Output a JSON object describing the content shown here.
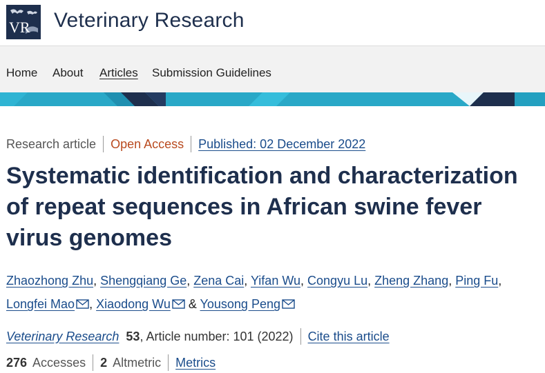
{
  "header": {
    "logo_text": "VR",
    "journal_title": "Veterinary Research"
  },
  "nav": {
    "items": [
      {
        "label": "Home"
      },
      {
        "label": "About"
      },
      {
        "label": "Articles"
      },
      {
        "label": "Submission Guidelines"
      }
    ],
    "active": "Articles"
  },
  "meta": {
    "type": "Research article",
    "access": "Open Access",
    "published": "Published: 02 December 2022"
  },
  "article": {
    "title": "Systematic identification and characterization of repeat sequences in African swine fever virus genomes"
  },
  "authors": [
    {
      "name": "Zhaozhong Zhu",
      "corresponding": false
    },
    {
      "name": "Shengqiang Ge",
      "corresponding": false
    },
    {
      "name": "Zena Cai",
      "corresponding": false
    },
    {
      "name": "Yifan Wu",
      "corresponding": false
    },
    {
      "name": "Congyu Lu",
      "corresponding": false
    },
    {
      "name": "Zheng Zhang",
      "corresponding": false
    },
    {
      "name": "Ping Fu",
      "corresponding": false
    },
    {
      "name": "Longfei Mao",
      "corresponding": true
    },
    {
      "name": "Xiaodong Wu",
      "corresponding": true
    },
    {
      "name": "Yousong Peng",
      "corresponding": true
    }
  ],
  "citation": {
    "journal": "Veterinary Research",
    "volume": "53",
    "article_number": ", Article number: 101 (2022)",
    "cite_link": "Cite this article"
  },
  "metrics": {
    "accesses_count": "276",
    "accesses_label": "Accesses",
    "altmetric_count": "2",
    "altmetric_label": "Altmetric",
    "metrics_link": "Metrics"
  },
  "colors": {
    "navy": "#1e2f4d",
    "link": "#1a4c8b",
    "open_access": "#b94a1f",
    "banner_teal": "#29a8c7"
  },
  "icons": {
    "mail": "envelope-icon"
  }
}
